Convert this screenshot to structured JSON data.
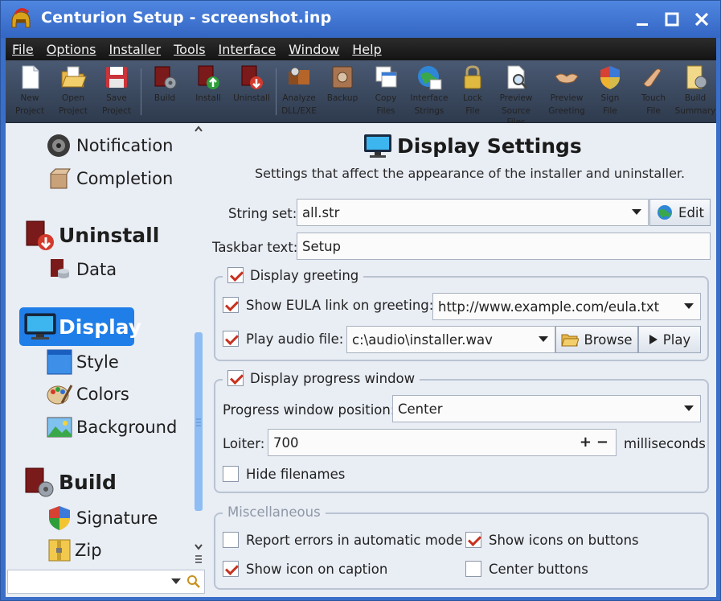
{
  "window": {
    "title": "Centurion Setup - screenshot.inp"
  },
  "menu": [
    "File",
    "Options",
    "Installer",
    "Tools",
    "Interface",
    "Window",
    "Help"
  ],
  "toolbar": [
    {
      "line1": "New",
      "line2": "Project",
      "icon": "new-project-icon"
    },
    {
      "line1": "Open",
      "line2": "Project",
      "icon": "open-project-icon"
    },
    {
      "line1": "Save",
      "line2": "Project",
      "icon": "save-project-icon"
    },
    {
      "line1": "Build",
      "line2": "",
      "icon": "build-icon"
    },
    {
      "line1": "Install",
      "line2": "",
      "icon": "install-icon"
    },
    {
      "line1": "Uninstall",
      "line2": "",
      "icon": "uninstall-icon"
    },
    {
      "line1": "Analyze",
      "line2": "DLL/EXE",
      "icon": "analyze-icon"
    },
    {
      "line1": "Backup",
      "line2": "",
      "icon": "backup-icon"
    },
    {
      "line1": "Copy",
      "line2": "Files",
      "icon": "copy-files-icon"
    },
    {
      "line1": "Interface",
      "line2": "Strings",
      "icon": "interface-strings-icon"
    },
    {
      "line1": "Lock",
      "line2": "File",
      "icon": "lock-icon"
    },
    {
      "line1": "Preview",
      "line2": "Source Files",
      "icon": "preview-source-icon"
    },
    {
      "line1": "Preview",
      "line2": "Greeting",
      "icon": "preview-greeting-icon"
    },
    {
      "line1": "Sign",
      "line2": "File",
      "icon": "sign-file-icon"
    },
    {
      "line1": "Touch",
      "line2": "File",
      "icon": "touch-file-icon"
    },
    {
      "line1": "Build",
      "line2": "Summary",
      "icon": "build-summary-icon"
    }
  ],
  "sidebar": {
    "items": [
      {
        "label": "Notification",
        "kind": "sub"
      },
      {
        "label": "Completion",
        "kind": "sub"
      },
      {
        "label": "Uninstall",
        "kind": "head"
      },
      {
        "label": "Data",
        "kind": "sub"
      },
      {
        "label": "Display",
        "kind": "head",
        "active": true
      },
      {
        "label": "Style",
        "kind": "sub"
      },
      {
        "label": "Colors",
        "kind": "sub"
      },
      {
        "label": "Background",
        "kind": "sub"
      },
      {
        "label": "Build",
        "kind": "head"
      },
      {
        "label": "Signature",
        "kind": "sub"
      },
      {
        "label": "Zip",
        "kind": "sub"
      }
    ]
  },
  "main": {
    "title": "Display Settings",
    "subtitle": "Settings that affect the appearance of the installer and uninstaller.",
    "string_set_label": "String set:",
    "string_set_value": "all.str",
    "edit_label": "Edit",
    "taskbar_label": "Taskbar text:",
    "taskbar_value": "Setup",
    "greeting": {
      "legend": "Display greeting",
      "checked": true,
      "eula_label": "Show EULA link on greeting:",
      "eula_checked": true,
      "eula_value": "http://www.example.com/eula.txt",
      "audio_label": "Play audio file:",
      "audio_checked": true,
      "audio_value": "c:\\audio\\installer.wav",
      "browse_label": "Browse",
      "play_label": "Play"
    },
    "progress": {
      "legend": "Display progress window",
      "checked": true,
      "position_label": "Progress window position:",
      "position_value": "Center",
      "loiter_label": "Loiter:",
      "loiter_value": "700",
      "loiter_unit": "milliseconds",
      "plus": "+",
      "minus": "−",
      "hide_label": "Hide filenames",
      "hide_checked": false
    },
    "misc": {
      "legend": "Miscellaneous",
      "report_label": "Report errors in automatic mode",
      "report_checked": false,
      "show_icons_label": "Show icons on buttons",
      "show_icons_checked": true,
      "caption_label": "Show icon on caption",
      "caption_checked": true,
      "center_label": "Center buttons",
      "center_checked": false
    }
  },
  "colors": {
    "titlebar": "#3a6fc9",
    "active_item": "#1f7ee8",
    "check": "#c8311e"
  }
}
